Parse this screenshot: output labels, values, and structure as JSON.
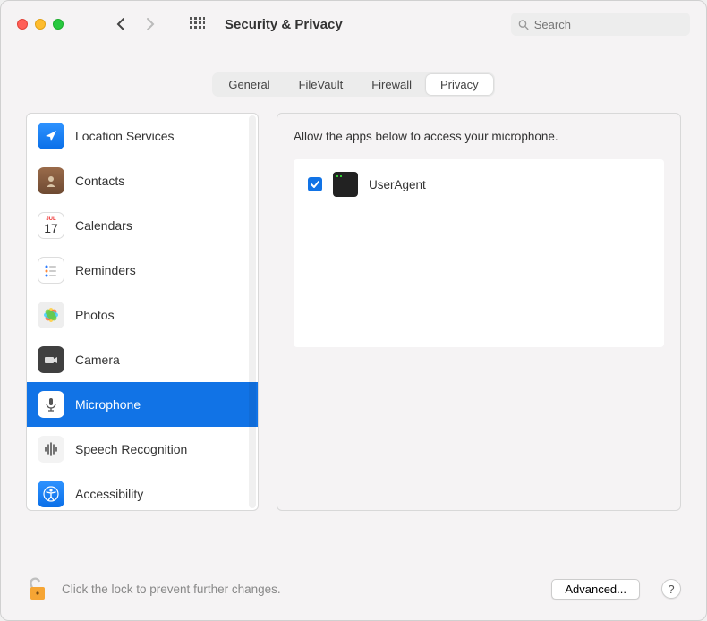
{
  "window": {
    "title": "Security & Privacy"
  },
  "search": {
    "placeholder": "Search"
  },
  "tabs": [
    {
      "label": "General"
    },
    {
      "label": "FileVault"
    },
    {
      "label": "Firewall"
    },
    {
      "label": "Privacy",
      "active": true
    }
  ],
  "sidebar": {
    "items": [
      {
        "label": "Location Services",
        "icon": "location-arrow",
        "bg": "ic-blue"
      },
      {
        "label": "Contacts",
        "icon": "contacts",
        "bg": "ic-brown"
      },
      {
        "label": "Calendars",
        "icon": "calendar",
        "bg": "ic-white",
        "badge": "17",
        "month": "JUL"
      },
      {
        "label": "Reminders",
        "icon": "reminders",
        "bg": "ic-white"
      },
      {
        "label": "Photos",
        "icon": "photos",
        "bg": "ic-multi"
      },
      {
        "label": "Camera",
        "icon": "camera",
        "bg": "ic-dark"
      },
      {
        "label": "Microphone",
        "icon": "microphone",
        "bg": "ic-blue",
        "selected": true
      },
      {
        "label": "Speech Recognition",
        "icon": "speech",
        "bg": "ic-light"
      },
      {
        "label": "Accessibility",
        "icon": "accessibility",
        "bg": "ic-blue"
      }
    ]
  },
  "main": {
    "description": "Allow the apps below to access your microphone.",
    "apps": [
      {
        "name": "UserAgent",
        "checked": true
      }
    ]
  },
  "footer": {
    "lock_text": "Click the lock to prevent further changes.",
    "advanced_label": "Advanced...",
    "help_label": "?"
  }
}
